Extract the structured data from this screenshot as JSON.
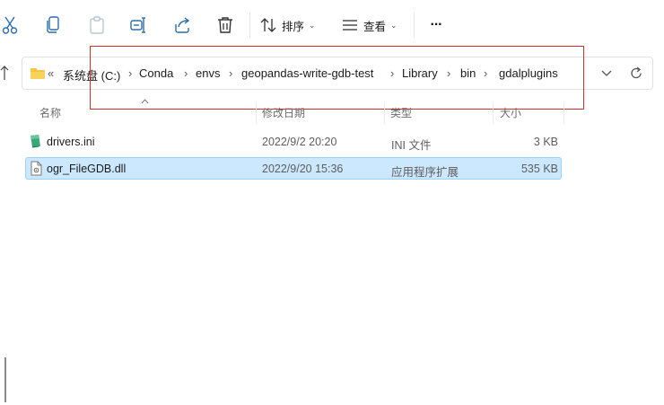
{
  "toolbar": {
    "sort_label": "排序",
    "view_label": "查看",
    "more_label": "···"
  },
  "address": {
    "overflow": "«",
    "crumbs": [
      "系统盘 (C:)",
      "Conda",
      "envs",
      "geopandas-write-gdb-test",
      "Library",
      "bin",
      "gdalplugins"
    ],
    "separator": "›"
  },
  "columns": {
    "name": "名称",
    "modified": "修改日期",
    "type": "类型",
    "size": "大小"
  },
  "files": [
    {
      "name": "drivers.ini",
      "modified": "2022/9/2 20:20",
      "type": "INI 文件",
      "size": "3 KB",
      "selected": false
    },
    {
      "name": "ogr_FileGDB.dll",
      "modified": "2022/9/20 15:36",
      "type": "应用程序扩展",
      "size": "535 KB",
      "selected": true
    }
  ],
  "colors": {
    "selection": "#cce8ff",
    "annotation": "#d32f2f",
    "folder": "#f4c542"
  }
}
